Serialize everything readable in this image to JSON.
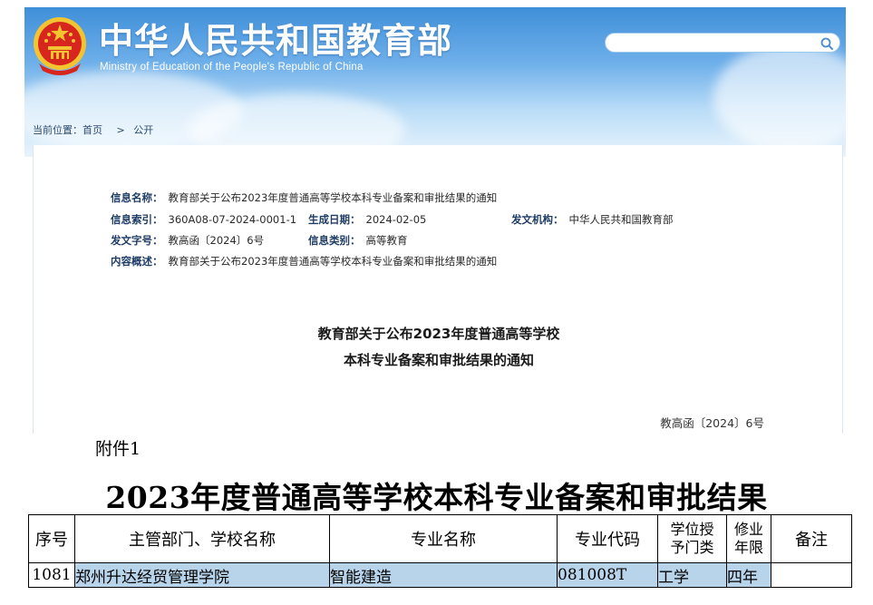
{
  "header": {
    "title": "中华人民共和国教育部",
    "subtitle": "Ministry of Education of the People's Republic of China",
    "search_placeholder": ""
  },
  "breadcrumb": {
    "prefix": "当前位置：",
    "home": "首页",
    "separator": ">",
    "current": "公开"
  },
  "meta": {
    "name_label": "信息名称：",
    "name_value": "教育部关于公布2023年度普通高等学校本科专业备案和审批结果的通知",
    "index_label": "信息索引：",
    "index_value": "360A08-07-2024-0001-1",
    "date_label": "生成日期：",
    "date_value": "2024-02-05",
    "org_label": "发文机构：",
    "org_value": "中华人民共和国教育部",
    "docno_label": "发文字号：",
    "docno_value": "教高函〔2024〕6号",
    "category_label": "信息类别：",
    "category_value": "高等教育",
    "summary_label": "内容概述：",
    "summary_value": "教育部关于公布2023年度普通高等学校本科专业备案和审批结果的通知"
  },
  "article": {
    "title_line1": "教育部关于公布2023年度普通高等学校",
    "title_line2": "本科专业备案和审批结果的通知",
    "doc_number": "教高函〔2024〕6号"
  },
  "attachment": {
    "label": "附件1",
    "title": "2023年度普通高等学校本科专业备案和审批结果",
    "headers": {
      "seq": "序号",
      "school": "主管部门、学校名称",
      "major": "专业名称",
      "code": "专业代码",
      "category_l1": "学位授",
      "category_l2": "予门类",
      "years_l1": "修业",
      "years_l2": "年限",
      "note": "备注"
    },
    "row": {
      "seq": "1081",
      "school": "郑州升达经贸管理学院",
      "major": "智能建造",
      "code": "081008T",
      "category": "工学",
      "years": "四年",
      "note": ""
    }
  },
  "colors": {
    "header_blue": "#3f8fd9",
    "title_blue": "#1f3d66",
    "row_highlight": "#b8d4ea",
    "emblem_red": "#d7261e",
    "emblem_gold": "#f4c430"
  },
  "icons": {
    "emblem": "national-emblem-icon",
    "search": "search-icon"
  }
}
